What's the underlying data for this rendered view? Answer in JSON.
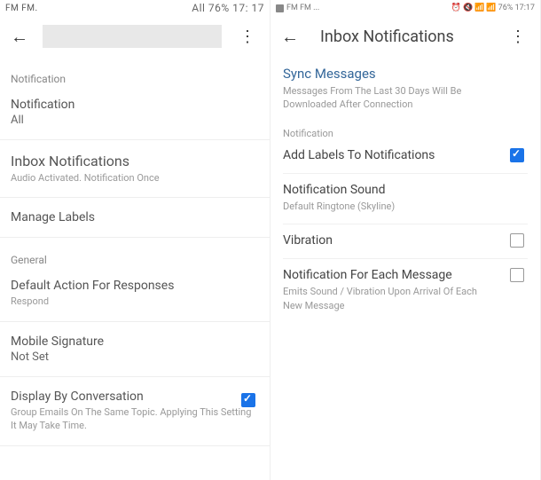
{
  "left": {
    "statusbar": {
      "carrier": "FM FM.",
      "center": "All 76% 17: 17"
    },
    "sections": {
      "notification_label": "Notification",
      "notification_title": "Notification",
      "notification_value": "All",
      "inbox_title": "Inbox Notifications",
      "inbox_sub": "Audio Activated. Notification Once",
      "manage_labels": "Manage Labels",
      "general": "General",
      "default_action_title": "Default Action For Responses",
      "default_action_value": "Respond",
      "mobile_sig_title": "Mobile Signature",
      "mobile_sig_value": "Not Set",
      "conversation_title": "Display By Conversation",
      "conversation_sub": "Group Emails On The Same Topic. Applying This Setting It May Take Time."
    }
  },
  "right": {
    "statusbar": {
      "carrier": "FM FM ...",
      "battery": "76% 17:17"
    },
    "header": "Inbox Notifications",
    "sync_title": "Sync Messages",
    "sync_sub": "Messages From The Last 30 Days Will Be Downloaded After Connection",
    "notification_label": "Notification",
    "add_labels": "Add Labels To Notifications",
    "sound_title": "Notification Sound",
    "sound_sub": "Default Ringtone (Skyline)",
    "vibration": "Vibration",
    "each_title": "Notification For Each Message",
    "each_sub": "Emits Sound / Vibration Upon Arrival Of Each New Message"
  }
}
